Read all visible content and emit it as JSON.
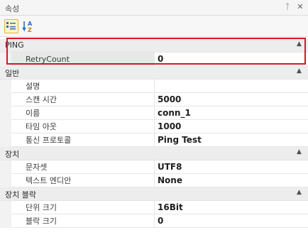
{
  "panel": {
    "title": "속성",
    "pin_glyph": "ᛏ",
    "close_glyph": "✕"
  },
  "toolbar": {
    "categorized_icon": "categorized-view-icon",
    "alphabetical_icon": "alphabetical-sort-icon"
  },
  "accent": "#d9161f",
  "categories": [
    {
      "label": "PING",
      "properties": [
        {
          "name": "RetryCount",
          "value": "0"
        }
      ]
    },
    {
      "label": "일반",
      "properties": [
        {
          "name": "설명",
          "value": ""
        },
        {
          "name": "스캔 시간",
          "value": "5000"
        },
        {
          "name": "이름",
          "value": "conn_1"
        },
        {
          "name": "타임 아웃",
          "value": "1000"
        },
        {
          "name": "통신 프로토콜",
          "value": "Ping Test"
        }
      ]
    },
    {
      "label": "장치",
      "properties": [
        {
          "name": "문자셋",
          "value": "UTF8"
        },
        {
          "name": "텍스트 엔디안",
          "value": "None"
        }
      ]
    },
    {
      "label": "장치 블락",
      "properties": [
        {
          "name": "단위 크기",
          "value": "16Bit"
        },
        {
          "name": "블락 크기",
          "value": "0"
        }
      ]
    }
  ]
}
